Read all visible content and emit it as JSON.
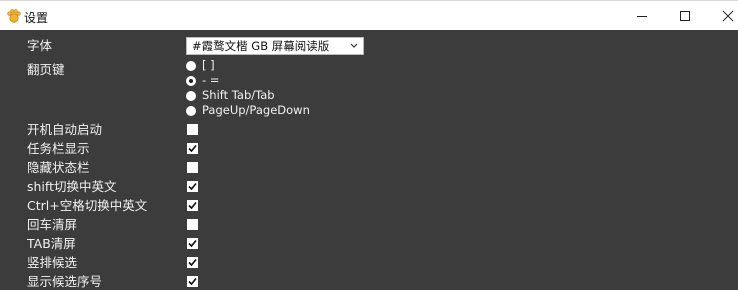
{
  "window": {
    "title": "设置",
    "app_icon": "cat-paw-icon",
    "controls": [
      "minimize-icon",
      "maximize-icon",
      "close-icon"
    ]
  },
  "settings": {
    "font": {
      "label": "字体",
      "value": "#霞鹜文楷 GB 屏幕阅读版"
    },
    "page_keys": {
      "label": "翻页键",
      "options": [
        {
          "label": "[ ]",
          "checked": false
        },
        {
          "label": "- =",
          "checked": true
        },
        {
          "label": "Shift Tab/Tab",
          "checked": false
        },
        {
          "label": "PageUp/PageDown",
          "checked": false
        }
      ]
    },
    "toggles": [
      {
        "label": "开机自动启动",
        "checked": false
      },
      {
        "label": "任务栏显示",
        "checked": true
      },
      {
        "label": "隐藏状态栏",
        "checked": false
      },
      {
        "label": "shift切换中英文",
        "checked": true
      },
      {
        "label": "Ctrl+空格切换中英文",
        "checked": true
      },
      {
        "label": "回车清屏",
        "checked": false
      },
      {
        "label": "TAB清屏",
        "checked": true
      },
      {
        "label": "竖排候选",
        "checked": true
      },
      {
        "label": "显示候选序号",
        "checked": true
      }
    ]
  },
  "colors": {
    "background": "#3c3c3c",
    "titlebar": "#ffffff",
    "text": "#f2f2f2"
  }
}
